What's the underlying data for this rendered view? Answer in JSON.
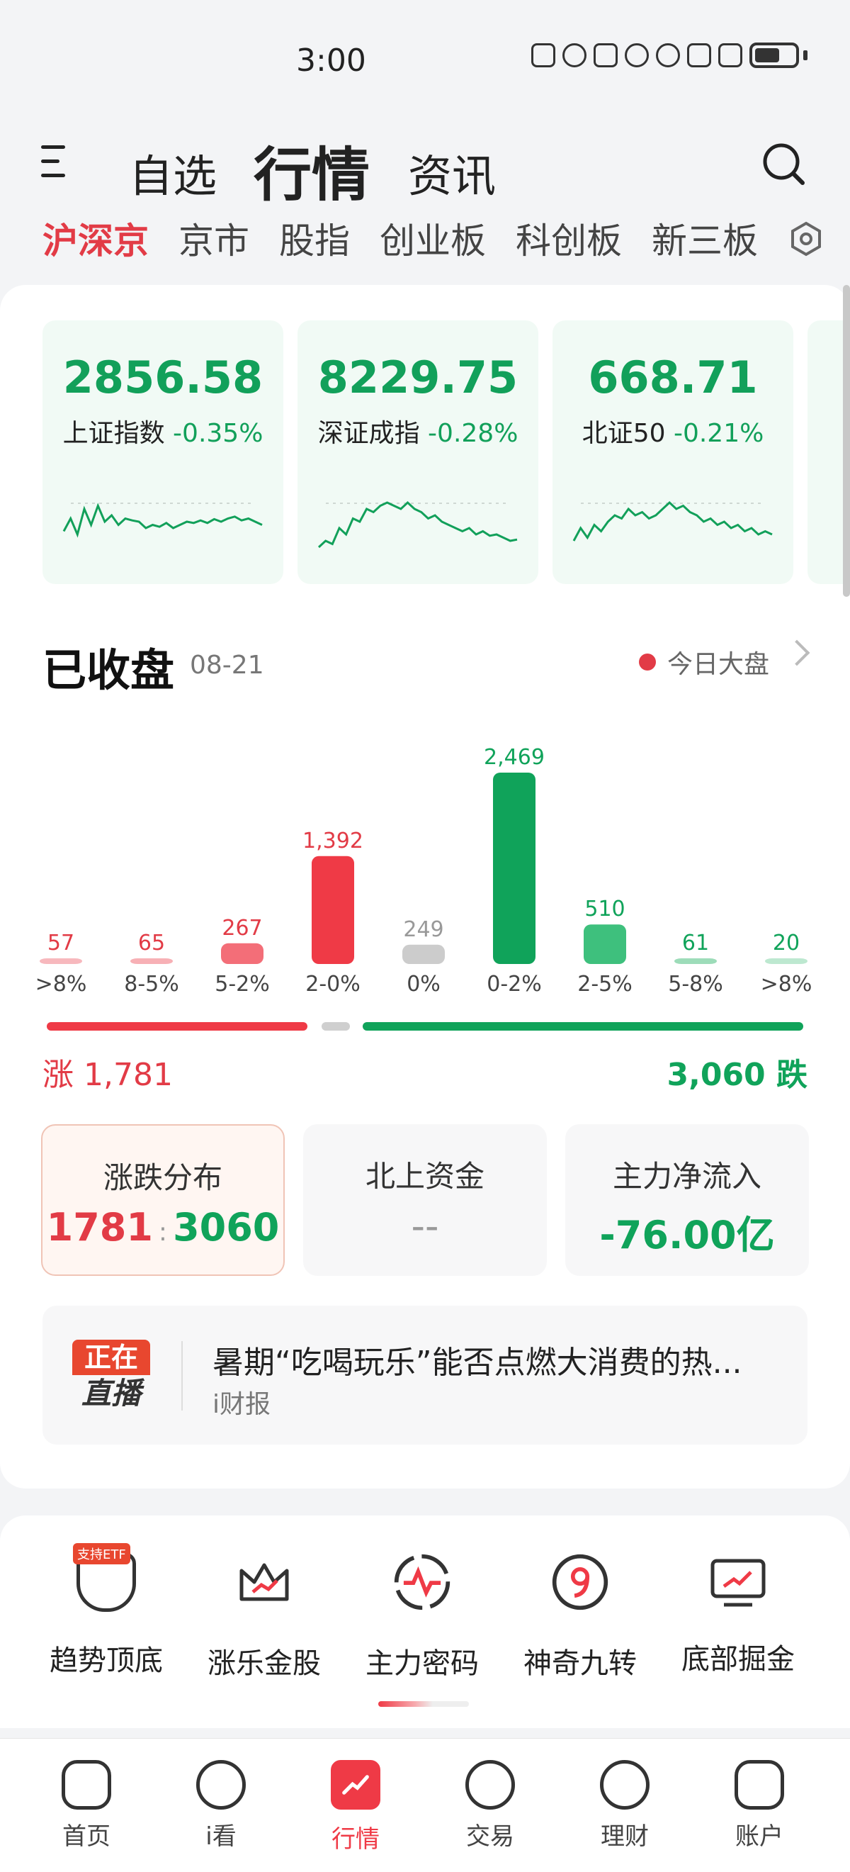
{
  "status": {
    "time": "3:00"
  },
  "header": {
    "tabs": [
      {
        "label": "自选"
      },
      {
        "label": "行情"
      },
      {
        "label": "资讯"
      }
    ],
    "active_tab": "行情"
  },
  "market_tabs": {
    "items": [
      "沪深京",
      "京市",
      "股指",
      "创业板",
      "科创板",
      "新三板"
    ],
    "active": "沪深京"
  },
  "indices": [
    {
      "value": "2856.58",
      "name": "上证指数",
      "change": "-0.35%",
      "spark": [
        0.55,
        0.35,
        0.6,
        0.2,
        0.45,
        0.15,
        0.4,
        0.3,
        0.45,
        0.35,
        0.38,
        0.4,
        0.5,
        0.45,
        0.48,
        0.42,
        0.5,
        0.45,
        0.4,
        0.42,
        0.38,
        0.42,
        0.36,
        0.4,
        0.35,
        0.32,
        0.38,
        0.35,
        0.4,
        0.45
      ]
    },
    {
      "value": "8229.75",
      "name": "深证成指",
      "change": "-0.28%",
      "spark": [
        0.8,
        0.7,
        0.75,
        0.5,
        0.6,
        0.35,
        0.4,
        0.2,
        0.25,
        0.15,
        0.1,
        0.15,
        0.2,
        0.1,
        0.2,
        0.25,
        0.35,
        0.3,
        0.4,
        0.45,
        0.5,
        0.55,
        0.5,
        0.6,
        0.55,
        0.62,
        0.6,
        0.65,
        0.7,
        0.68
      ]
    },
    {
      "value": "668.71",
      "name": "北证50",
      "change": "-0.21%",
      "spark": [
        0.7,
        0.5,
        0.65,
        0.45,
        0.55,
        0.4,
        0.3,
        0.35,
        0.2,
        0.3,
        0.25,
        0.35,
        0.3,
        0.2,
        0.1,
        0.2,
        0.15,
        0.25,
        0.3,
        0.4,
        0.35,
        0.45,
        0.4,
        0.5,
        0.45,
        0.55,
        0.5,
        0.6,
        0.55,
        0.6
      ]
    }
  ],
  "closed": {
    "title": "已收盘",
    "date": "08-21",
    "today_link": "今日大盘"
  },
  "chart_data": {
    "type": "bar",
    "categories": [
      ">8%",
      "8-5%",
      "5-2%",
      "2-0%",
      "0%",
      "0-2%",
      "2-5%",
      "5-8%",
      ">8%"
    ],
    "values": [
      57,
      65,
      267,
      1392,
      249,
      2469,
      510,
      61,
      20
    ],
    "labels": [
      "57",
      "65",
      "267",
      "1,392",
      "249",
      "2,469",
      "510",
      "61",
      "20"
    ],
    "colors": [
      "#f7b8bd",
      "#f7b0b5",
      "#f36e78",
      "#ef3a46",
      "#cccccc",
      "#10a35a",
      "#3ec07d",
      "#9ddcb9",
      "#bde8d0"
    ],
    "label_colors": [
      "#e23b46",
      "#e23b46",
      "#e23b46",
      "#e23b46",
      "#999999",
      "#10a35a",
      "#10a35a",
      "#10a35a",
      "#10a35a"
    ],
    "ylim": [
      0,
      2469
    ]
  },
  "summary": {
    "rise": "涨 1,781",
    "fall": "3,060 跌"
  },
  "stats": [
    {
      "title": "涨跌分布",
      "up": "1781",
      "sep": ":",
      "down": "3060"
    },
    {
      "title": "北上资金",
      "value": "--"
    },
    {
      "title": "主力净流入",
      "value": "-76.00亿"
    }
  ],
  "live": {
    "badge_top": "正在",
    "badge_bottom": "直播",
    "title": "暑期“吃喝玩乐”能否点燃大消费的热...",
    "source": "i财报"
  },
  "tools": [
    {
      "label": "趋势顶底",
      "icon": "shield-chart-icon",
      "tag": "支持ETF"
    },
    {
      "label": "涨乐金股",
      "icon": "crown-icon"
    },
    {
      "label": "主力密码",
      "icon": "pulse-circle-icon"
    },
    {
      "label": "神奇九转",
      "icon": "nine-circle-icon"
    },
    {
      "label": "底部掘金",
      "icon": "monitor-chart-icon"
    }
  ],
  "bottom_nav": [
    {
      "label": "首页",
      "icon": "home-icon"
    },
    {
      "label": "i看",
      "icon": "play-icon"
    },
    {
      "label": "行情",
      "icon": "chart-icon"
    },
    {
      "label": "交易",
      "icon": "exchange-icon"
    },
    {
      "label": "理财",
      "icon": "diamond-icon"
    },
    {
      "label": "账户",
      "icon": "account-icon"
    }
  ],
  "bottom_nav_active": "行情",
  "colors": {
    "up": "#e23b46",
    "down": "#10a35a",
    "accent": "#ef3a46"
  }
}
